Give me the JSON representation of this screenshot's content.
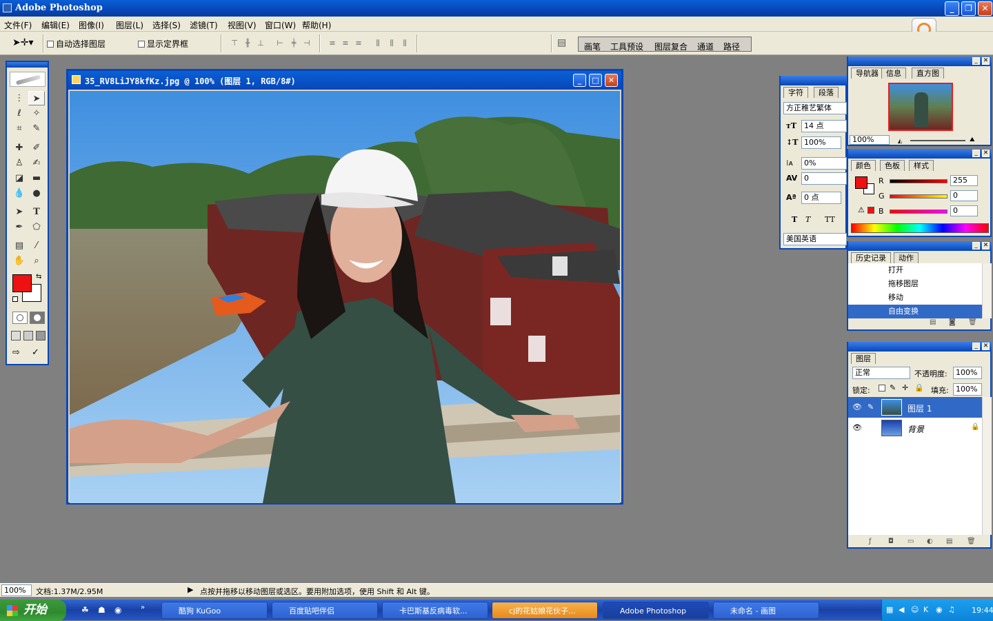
{
  "app": {
    "title": "Adobe Photoshop"
  },
  "menu": [
    "文件(F)",
    "编辑(E)",
    "图像(I)",
    "图层(L)",
    "选择(S)",
    "滤镜(T)",
    "视图(V)",
    "窗口(W)",
    "帮助(H)"
  ],
  "options": {
    "auto_select": "自动选择图层",
    "show_bounds": "显示定界框"
  },
  "wells": [
    "画笔",
    "工具预设",
    "图层复合",
    "通道",
    "路径"
  ],
  "document": {
    "title": "35_RV8LiJY8kfKz.jpg @ 100% (图层 1, RGB/8#)"
  },
  "character": {
    "tabs": [
      "字符",
      "段落"
    ],
    "font": "方正稚艺繁体",
    "size": "14 点",
    "vscale": "100%",
    "tracking_pct": "0%",
    "kerning": "0",
    "baseline": "0 点",
    "language": "美国英语"
  },
  "navigator": {
    "tabs": [
      "导航器",
      "信息",
      "直方图"
    ],
    "zoom": "100%"
  },
  "color": {
    "tabs": [
      "颜色",
      "色板",
      "样式"
    ],
    "r_label": "R",
    "g_label": "G",
    "b_label": "B",
    "r": "255",
    "g": "0",
    "b": "0",
    "fg": "#ee1111"
  },
  "history": {
    "tabs": [
      "历史记录",
      "动作"
    ],
    "items": [
      "打开",
      "拖移图层",
      "移动",
      "自由变换"
    ]
  },
  "layers": {
    "tab": "图层",
    "blend_mode": "正常",
    "opacity_label": "不透明度:",
    "opacity": "100%",
    "lock_label": "锁定:",
    "fill_label": "填充:",
    "fill": "100%",
    "items": [
      "图层 1",
      "背景"
    ]
  },
  "status": {
    "zoom": "100%",
    "doc": "文档:1.37M/2.95M",
    "hint": "点按并拖移以移动图层或选区。要用附加选项，使用 Shift 和 Alt 键。"
  },
  "taskbar": {
    "start": "开始",
    "tasks": [
      "酷狗 KuGoo",
      "百度贴吧伴侣",
      "卡巴斯基反病毒软...",
      "cj的花姑娘花伙子...",
      "Adobe Photoshop",
      "未命名 - 画图"
    ],
    "time": "19:44"
  }
}
